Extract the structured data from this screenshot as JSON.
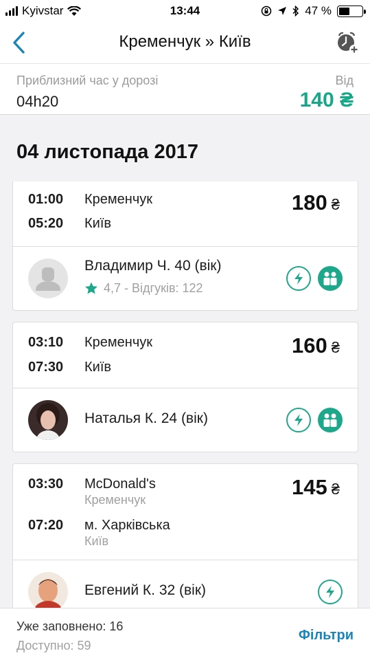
{
  "status_bar": {
    "carrier": "Kyivstar",
    "time": "13:44",
    "battery": "47 %",
    "battery_level": 0.47,
    "icons": [
      "signal-icon",
      "wifi-icon",
      "rotation-lock-icon",
      "location-icon",
      "bluetooth-icon",
      "battery-icon"
    ]
  },
  "nav": {
    "title": "Кременчук » Київ",
    "back_icon": "chevron-left-icon",
    "alarm_icon": "alarm-add-icon"
  },
  "summary": {
    "travel_label": "Приблизний час у дорозі",
    "travel_value": "04h20",
    "from_label": "Від",
    "from_price": "140 ₴"
  },
  "date_header": "04 листопада 2017",
  "trips": [
    {
      "depart_time": "01:00",
      "depart_place": "Кременчук",
      "arrive_time": "05:20",
      "arrive_place": "Київ",
      "price": "180",
      "currency": "₴",
      "driver": "Владимир Ч. 40 (вік)",
      "rating": "4,7 - Відгуків: 122",
      "badges": [
        "lightning-icon",
        "passengers-icon"
      ]
    },
    {
      "depart_time": "03:10",
      "depart_place": "Кременчук",
      "arrive_time": "07:30",
      "arrive_place": "Київ",
      "price": "160",
      "currency": "₴",
      "driver": "Наталья К. 24 (вік)",
      "badges": [
        "lightning-icon",
        "passengers-icon"
      ]
    },
    {
      "depart_time": "03:30",
      "depart_place": "McDonald's",
      "depart_city": "Кременчук",
      "arrive_time": "07:20",
      "arrive_place": "м. Харківська",
      "arrive_city": "Київ",
      "price": "145",
      "currency": "₴",
      "driver": "Евгений К. 32 (вік)",
      "badges": [
        "lightning-icon"
      ]
    }
  ],
  "footer": {
    "filled": "Уже заповнено: 16",
    "available": "Доступно: 59",
    "filters": "Фільтри"
  },
  "colors": {
    "accent_green": "#17a88a",
    "link_blue": "#1b84b8",
    "background": "#f2f2f4"
  }
}
